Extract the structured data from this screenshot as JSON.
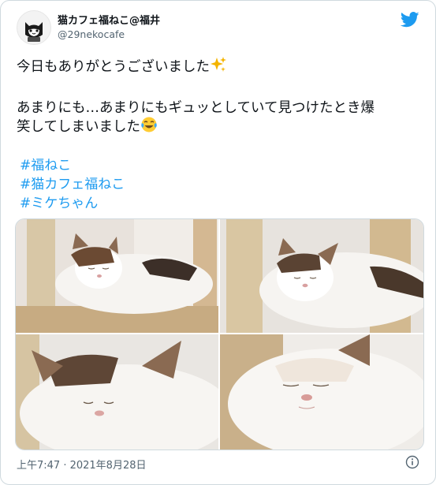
{
  "author": {
    "display_name": "猫カフェ福ねこ@福井",
    "handle": "@29nekocafe"
  },
  "tweet": {
    "line1": "今日もありがとうございました",
    "line2": "あまりにも…あまりにもギュッとしていて見つけたとき爆",
    "line3": "笑してしまいました",
    "hashtags": [
      "#福ねこ",
      "#猫カフェ福ねこ",
      "#ミケちゃん"
    ]
  },
  "emojis": [
    "sparkles",
    "face-with-tears-of-joy"
  ],
  "media": {
    "photo_count": 4,
    "subject": "calico cat sleeping"
  },
  "timestamp": "上午7:47 · 2021年8月28日",
  "icons": [
    "twitter-bird-icon",
    "info-icon"
  ],
  "colors": {
    "link": "#1d9bf0",
    "text": "#0f1419",
    "muted": "#536471",
    "border": "#cfd9de"
  }
}
